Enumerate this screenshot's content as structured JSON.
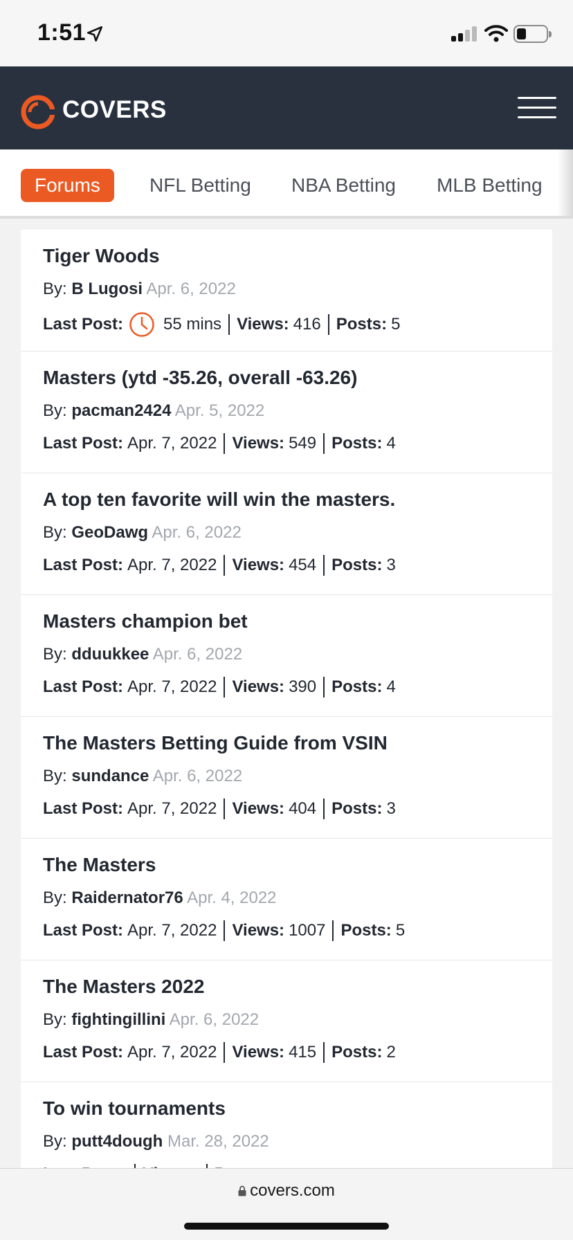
{
  "status_bar": {
    "time": "1:51"
  },
  "header": {
    "brand": "COVERS",
    "brand_color": "#ec5a24",
    "background": "#29313f"
  },
  "nav": {
    "tabs": [
      {
        "label": "Forums",
        "active": true
      },
      {
        "label": "NFL Betting",
        "active": false
      },
      {
        "label": "NBA Betting",
        "active": false
      },
      {
        "label": "MLB Betting",
        "active": false
      }
    ]
  },
  "labels": {
    "by": "By:",
    "last_post": "Last Post:",
    "views": "Views:",
    "posts": "Posts:"
  },
  "threads": [
    {
      "title": "Tiger Woods",
      "author": "B Lugosi",
      "date": "Apr. 6, 2022",
      "last_post": "55 mins",
      "views": "416",
      "posts": "5"
    },
    {
      "title": "Masters (ytd -35.26, overall -63.26)",
      "author": "pacman2424",
      "date": "Apr. 5, 2022",
      "last_post": "Apr. 7, 2022",
      "views": "549",
      "posts": "4"
    },
    {
      "title": "A top ten favorite will win the masters.",
      "author": "GeoDawg",
      "date": "Apr. 6, 2022",
      "last_post": "Apr. 7, 2022",
      "views": "454",
      "posts": "3"
    },
    {
      "title": "Masters champion bet",
      "author": "dduukkee",
      "date": "Apr. 6, 2022",
      "last_post": "Apr. 7, 2022",
      "views": "390",
      "posts": "4"
    },
    {
      "title": "The Masters Betting Guide from VSIN",
      "author": "sundance",
      "date": "Apr. 6, 2022",
      "last_post": "Apr. 7, 2022",
      "views": "404",
      "posts": "3"
    },
    {
      "title": "The Masters",
      "author": "Raidernator76",
      "date": "Apr. 4, 2022",
      "last_post": "Apr. 7, 2022",
      "views": "1007",
      "posts": "5"
    },
    {
      "title": "The Masters 2022",
      "author": "fightingillini",
      "date": "Apr. 6, 2022",
      "last_post": "Apr. 7, 2022",
      "views": "415",
      "posts": "2"
    },
    {
      "title": "To win tournaments",
      "author": "putt4dough",
      "date": "Mar. 28, 2022",
      "last_post": "",
      "views": "",
      "posts": ""
    }
  ],
  "browser": {
    "url": "covers.com"
  }
}
